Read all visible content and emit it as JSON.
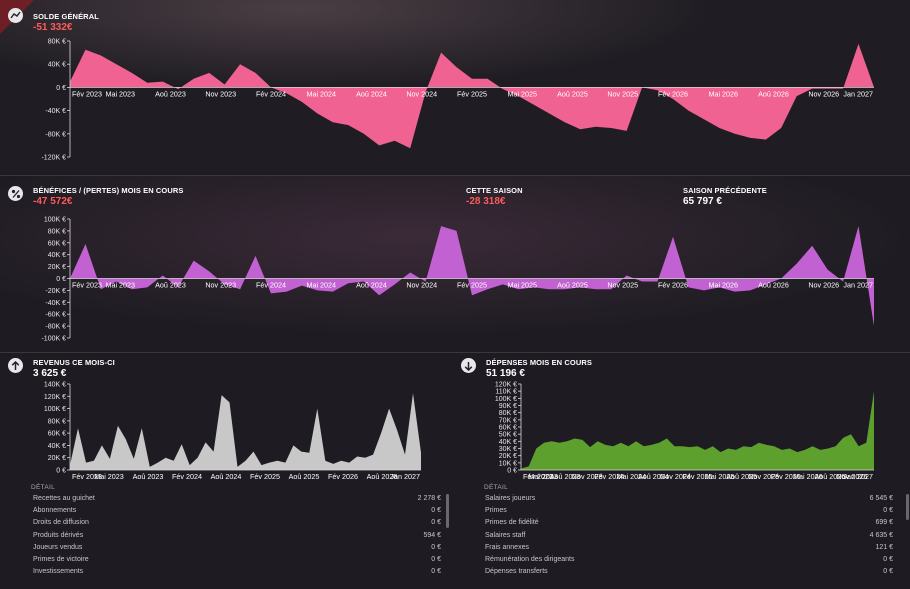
{
  "colors": {
    "pink": "#f06292",
    "purple": "#c262d2",
    "white_area": "#c8c8c8",
    "green": "#5ea02e",
    "negative": "#ff5a5a"
  },
  "balance": {
    "title": "SOLDE GÉNÉRAL",
    "value": "-51 332€",
    "icon": "scale-icon"
  },
  "profit": {
    "title": "BÉNÉFICES / (PERTES) MOIS EN COURS",
    "value": "-47 572€",
    "icon": "percent-icon",
    "season_title": "CETTE SAISON",
    "season_value": "-28 318€",
    "prev_title": "SAISON PRÉCÉDENTE",
    "prev_value": "65 797 €"
  },
  "income": {
    "title": "REVENUS CE MOIS-CI",
    "value": "3 625 €",
    "icon": "arrow-up-icon",
    "detail_label": "DÉTAIL",
    "rows": [
      {
        "label": "Recettes au guichet",
        "value": "2 278 €"
      },
      {
        "label": "Abonnements",
        "value": "0 €"
      },
      {
        "label": "Droits de diffusion",
        "value": "0 €"
      },
      {
        "label": "Produits dérivés",
        "value": "594 €"
      },
      {
        "label": "Joueurs vendus",
        "value": "0 €"
      },
      {
        "label": "Primes de victoire",
        "value": "0 €"
      },
      {
        "label": "Investissements",
        "value": "0 €"
      }
    ]
  },
  "expenses": {
    "title": "DÉPENSES MOIS EN COURS",
    "value": "51 196 €",
    "icon": "arrow-down-icon",
    "detail_label": "DÉTAIL",
    "rows": [
      {
        "label": "Salaires joueurs",
        "value": "6 545 €"
      },
      {
        "label": "Primes",
        "value": "0 €"
      },
      {
        "label": "Primes de fidélité",
        "value": "699 €"
      },
      {
        "label": "Salaires staff",
        "value": "4 635 €"
      },
      {
        "label": "Frais annexes",
        "value": "121 €"
      },
      {
        "label": "Rémunération des dirigeants",
        "value": "0 €"
      },
      {
        "label": "Dépenses transferts",
        "value": "0 €"
      }
    ]
  },
  "chart_data": [
    {
      "type": "area",
      "name": "balance",
      "x_labels": [
        "Fév 2023",
        "Mai 2023",
        "Aoû 2023",
        "Nov 2023",
        "Fév 2024",
        "Mai 2024",
        "Aoû 2024",
        "Nov 2024",
        "Fév 2025",
        "Mai 2025",
        "Aoû 2025",
        "Nov 2025",
        "Fév 2026",
        "Mai 2026",
        "Aoû 2026",
        "Nov 2026",
        "Jan 2027"
      ],
      "y_ticks": [
        "80K €",
        "40K €",
        "0 €",
        "-40K €",
        "-80K €",
        "-120K €"
      ],
      "y_tick_values": [
        80000,
        40000,
        0,
        -40000,
        -80000,
        -120000
      ],
      "ylim": [
        -120000,
        80000
      ],
      "values": [
        10000,
        65000,
        55000,
        40000,
        25000,
        8000,
        10000,
        -3000,
        15000,
        25000,
        5000,
        40000,
        25000,
        0,
        -10000,
        -25000,
        -45000,
        -60000,
        -65000,
        -80000,
        -100000,
        -92000,
        -105000,
        -8000,
        60000,
        35000,
        15000,
        15000,
        -3000,
        -15000,
        -30000,
        -45000,
        -60000,
        -72000,
        -68000,
        -70000,
        -75000,
        0,
        -5000,
        -20000,
        -40000,
        -55000,
        -70000,
        -80000,
        -87000,
        -90000,
        -70000,
        -15000,
        -2000,
        -2000,
        -2000,
        75000,
        0
      ]
    },
    {
      "type": "area",
      "name": "profit",
      "x_labels": [
        "Fév 2023",
        "Mai 2023",
        "Aoû 2023",
        "Nov 2023",
        "Fév 2024",
        "Mai 2024",
        "Aoû 2024",
        "Nov 2024",
        "Fév 2025",
        "Mai 2025",
        "Aoû 2025",
        "Nov 2025",
        "Fév 2026",
        "Mai 2026",
        "Aoû 2026",
        "Nov 2026",
        "Jan 2027"
      ],
      "y_ticks": [
        "100K €",
        "80K €",
        "60K €",
        "40K €",
        "20K €",
        "0 €",
        "-20K €",
        "-40K €",
        "-60K €",
        "-80K €",
        "-100K €"
      ],
      "y_tick_values": [
        100000,
        80000,
        60000,
        40000,
        20000,
        0,
        -20000,
        -40000,
        -60000,
        -80000,
        -100000
      ],
      "ylim": [
        -100000,
        100000
      ],
      "values": [
        0,
        58000,
        -18000,
        -5000,
        -18000,
        -15000,
        5000,
        -15000,
        30000,
        12000,
        -10000,
        -18000,
        38000,
        -25000,
        -22000,
        -12000,
        -20000,
        -22000,
        -8000,
        -5000,
        -28000,
        -10000,
        10000,
        -5000,
        88000,
        80000,
        -28000,
        -18000,
        -10000,
        -18000,
        -15000,
        -18000,
        -18000,
        -15000,
        -18000,
        -18000,
        5000,
        -5000,
        -5000,
        70000,
        -15000,
        -20000,
        -15000,
        -22000,
        -20000,
        -10000,
        0,
        25000,
        55000,
        15000,
        -5000,
        88000,
        -80000
      ]
    },
    {
      "type": "area",
      "name": "income",
      "x_labels": [
        "Fév 2023",
        "Mai 2023",
        "Aoû 2023",
        "Fév 2024",
        "Aoû 2024",
        "Fév 2025",
        "Aoû 2025",
        "Fév 2026",
        "Aoû 2026",
        "Jan 2027"
      ],
      "y_ticks": [
        "140K €",
        "120K €",
        "100K €",
        "80K €",
        "60K €",
        "40K €",
        "20K €",
        "0 €"
      ],
      "y_tick_values": [
        140000,
        120000,
        100000,
        80000,
        60000,
        40000,
        20000,
        0
      ],
      "ylim": [
        0,
        140000
      ],
      "values": [
        8000,
        68000,
        12000,
        15000,
        40000,
        18000,
        72000,
        50000,
        18000,
        68000,
        5000,
        12000,
        20000,
        15000,
        42000,
        8000,
        20000,
        45000,
        30000,
        122000,
        110000,
        5000,
        15000,
        30000,
        8000,
        12000,
        15000,
        12000,
        40000,
        30000,
        28000,
        100000,
        15000,
        10000,
        15000,
        12000,
        22000,
        20000,
        25000,
        60000,
        100000,
        65000,
        25000,
        125000,
        28000
      ]
    },
    {
      "type": "area",
      "name": "expenses",
      "x_labels": [
        "Fév 2023",
        "Mai 2023",
        "Aoû 2023",
        "Nov 2023",
        "Fév 2024",
        "Mai 2024",
        "Aoû 2024",
        "Nov 2024",
        "Fév 2025",
        "Mai 2025",
        "Aoû 2025",
        "Nov 2025",
        "Fév 2026",
        "Mai 2026",
        "Aoû 2026",
        "Nov 2026",
        "Jan 2027"
      ],
      "y_ticks": [
        "120K €",
        "110K €",
        "100K €",
        "90K €",
        "80K €",
        "70K €",
        "60K €",
        "50K €",
        "40K €",
        "30K €",
        "20K €",
        "10K €",
        "0 €"
      ],
      "y_tick_values": [
        120000,
        110000,
        100000,
        90000,
        80000,
        70000,
        60000,
        50000,
        40000,
        30000,
        20000,
        10000,
        0
      ],
      "ylim": [
        0,
        120000
      ],
      "values": [
        2000,
        5000,
        30000,
        38000,
        40000,
        38000,
        40000,
        44000,
        42000,
        32000,
        40000,
        35000,
        33000,
        38000,
        33000,
        40000,
        33000,
        35000,
        38000,
        44000,
        33000,
        33000,
        32000,
        33000,
        28000,
        33000,
        25000,
        30000,
        28000,
        33000,
        32000,
        38000,
        35000,
        33000,
        28000,
        30000,
        25000,
        28000,
        33000,
        28000,
        30000,
        33000,
        45000,
        50000,
        33000,
        38000,
        110000
      ]
    }
  ]
}
